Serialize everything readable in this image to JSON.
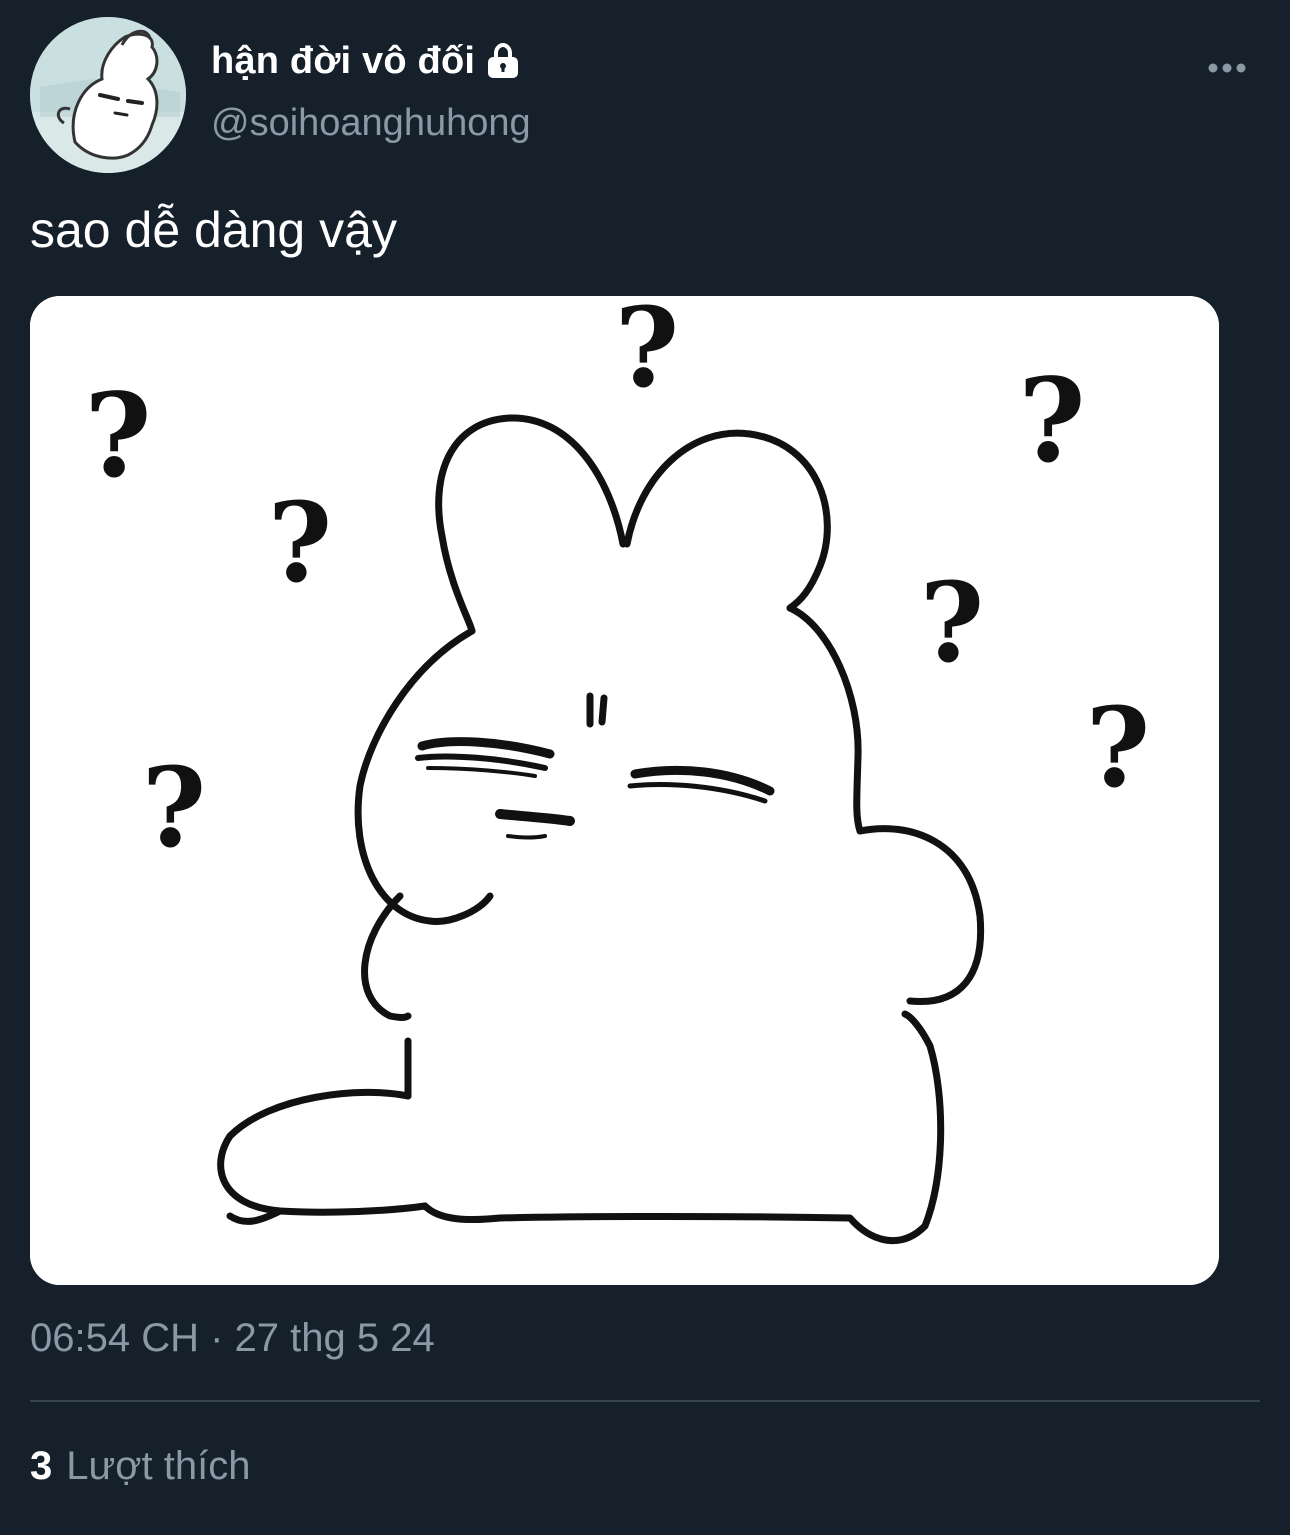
{
  "author": {
    "display_name": "hận đời vô đối",
    "handle": "@soihoanghuhong",
    "protected": true,
    "avatar_icon": "bunny-avatar-icon"
  },
  "tweet": {
    "text": "sao dễ dàng vậy",
    "timestamp": "06:54 CH · 27 thg 5 24",
    "media_icon": "confused-bunny-question-marks-image"
  },
  "stats": {
    "likes_count": "3",
    "likes_label": "Lượt thích"
  },
  "colors": {
    "background": "#15202b",
    "primary_text": "#ffffff",
    "secondary_text": "#8b98a5",
    "divider": "#38444d"
  }
}
